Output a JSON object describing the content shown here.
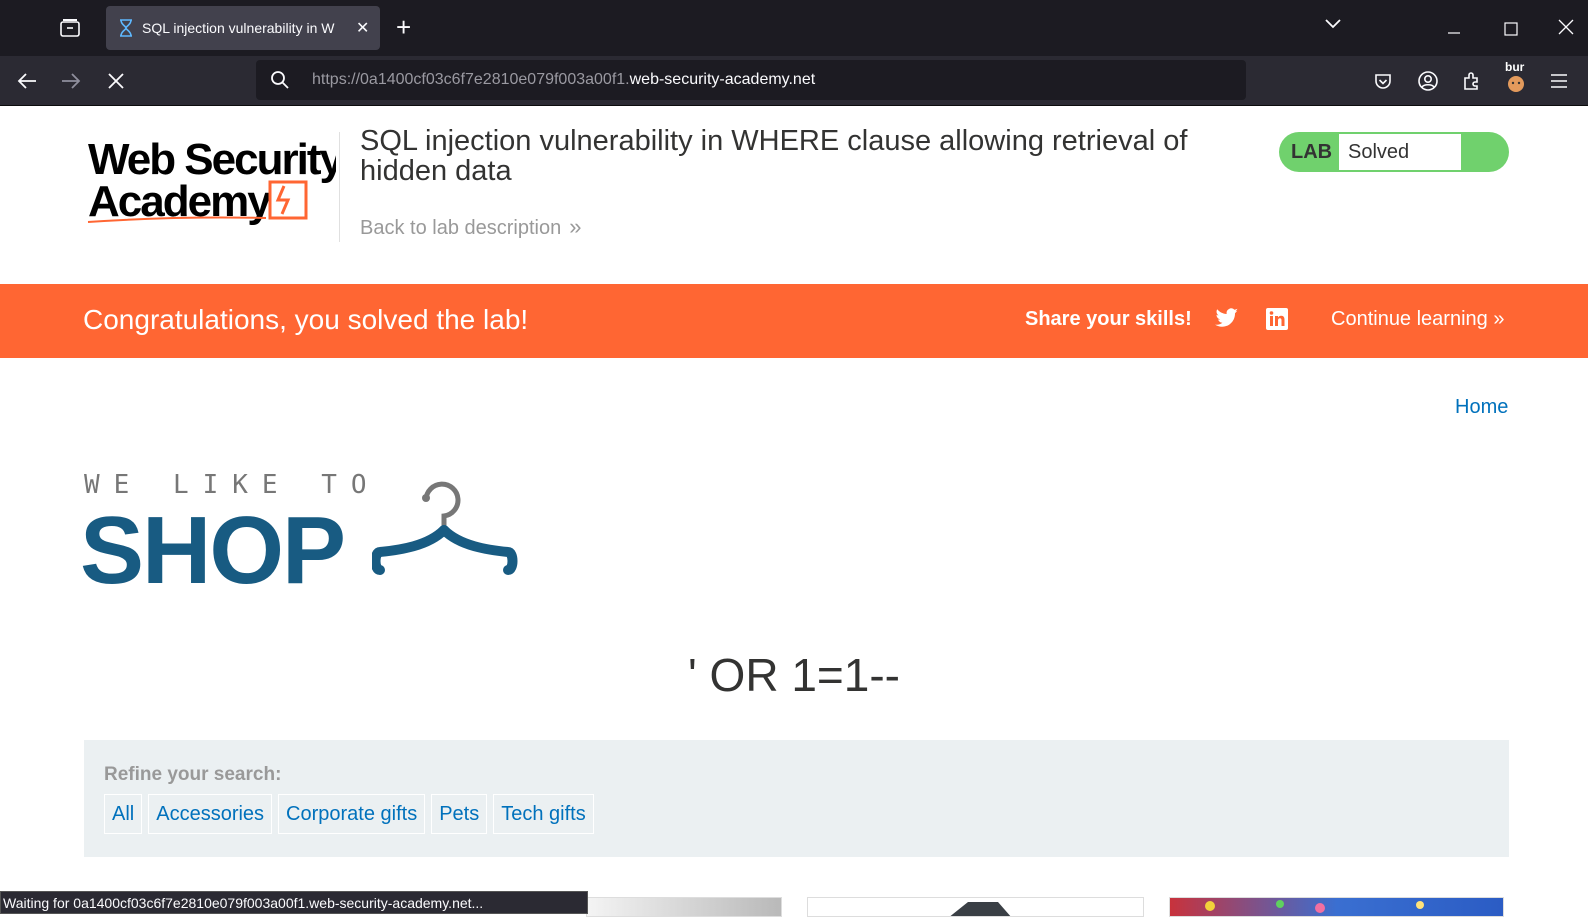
{
  "browser": {
    "tab_title": "SQL injection vulnerability in W",
    "url_prefix": "https://0a1400cf03c6f7e2810e079f003a00f1.",
    "url_host": "web-security-academy.net",
    "extension_badge": "bur",
    "status_text": "Waiting for 0a1400cf03c6f7e2810e079f003a00f1.web-security-academy.net..."
  },
  "lab": {
    "logo_line1": "Web Security",
    "logo_line2": "Academy",
    "title": "SQL injection vulnerability in WHERE clause allowing retrieval of hidden data",
    "back_link": "Back to lab description",
    "status_label": "LAB",
    "status_value": "Solved"
  },
  "banner": {
    "message": "Congratulations, you solved the lab!",
    "share": "Share your skills!",
    "continue": "Continue learning"
  },
  "shop": {
    "home_link": "Home",
    "tagline": "WE LIKE TO",
    "brand": "SHOP",
    "search_term": "' OR 1=1--",
    "refine_label": "Refine your search:",
    "filters": [
      "All",
      "Accessories",
      "Corporate gifts",
      "Pets",
      "Tech gifts"
    ]
  },
  "colors": {
    "banner": "#ff6633",
    "lab_solved": "#70d16d",
    "link": "#0071bc",
    "brand": "#185b82"
  }
}
